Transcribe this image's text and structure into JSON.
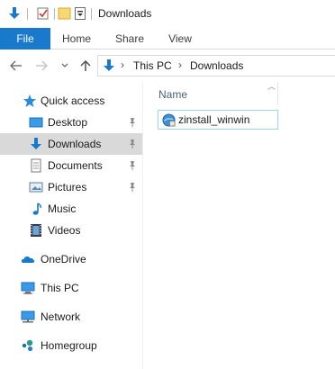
{
  "window": {
    "title": "Downloads"
  },
  "ribbon": {
    "tabs": [
      {
        "label": "File",
        "active": true
      },
      {
        "label": "Home"
      },
      {
        "label": "Share"
      },
      {
        "label": "View"
      }
    ]
  },
  "address": {
    "breadcrumbs": [
      "This PC",
      "Downloads"
    ]
  },
  "nav": {
    "quick_access": "Quick access",
    "items": [
      {
        "label": "Desktop",
        "icon": "desktop-icon",
        "pinned": true
      },
      {
        "label": "Downloads",
        "icon": "downloads-icon",
        "pinned": true,
        "selected": true
      },
      {
        "label": "Documents",
        "icon": "documents-icon",
        "pinned": true
      },
      {
        "label": "Pictures",
        "icon": "pictures-icon",
        "pinned": true
      },
      {
        "label": "Music",
        "icon": "music-icon"
      },
      {
        "label": "Videos",
        "icon": "videos-icon"
      }
    ],
    "onedrive": "OneDrive",
    "this_pc": "This PC",
    "network": "Network",
    "homegroup": "Homegroup"
  },
  "content": {
    "column_name": "Name",
    "files": [
      {
        "name": "zinstall_winwin",
        "icon": "installer-icon"
      }
    ]
  },
  "colors": {
    "accent": "#1979ca",
    "selected_nav": "#d9d9d9",
    "file_border": "#99d1ff"
  }
}
